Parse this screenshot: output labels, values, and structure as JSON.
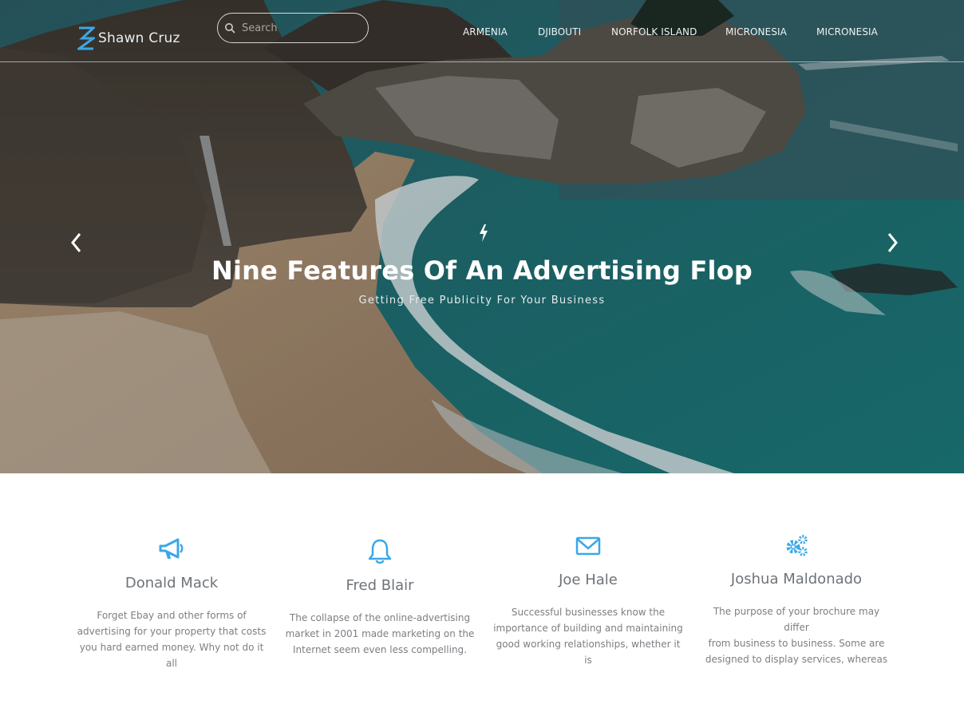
{
  "brand": {
    "name": "Shawn Cruz"
  },
  "search": {
    "placeholder": "Search"
  },
  "nav": {
    "items": [
      {
        "label": "ARMENIA"
      },
      {
        "label": "DJIBOUTI"
      },
      {
        "label": "NORFOLK ISLAND"
      },
      {
        "label": "MICRONESIA"
      },
      {
        "label": "MICRONESIA"
      }
    ]
  },
  "hero": {
    "title": "Nine Features Of An Advertising Flop",
    "subtitle": "Getting Free Publicity For Your Business"
  },
  "features": [
    {
      "icon": "megaphone-icon",
      "title": "Donald Mack",
      "lines": [
        "Forget Ebay and other forms of",
        "advertising for your property that costs",
        "you hard earned money. Why not do it all"
      ]
    },
    {
      "icon": "bell-icon",
      "title": "Fred Blair",
      "lines": [
        "The collapse of the online-advertising",
        "market in 2001 made marketing on the",
        "Internet seem even less compelling."
      ]
    },
    {
      "icon": "envelope-icon",
      "title": "Joe Hale",
      "lines": [
        "Successful businesses know the",
        "importance of building and maintaining",
        "good working relationships, whether it is"
      ]
    },
    {
      "icon": "gears-icon",
      "title": "Joshua Maldonado",
      "lines": [
        "The purpose of your brochure may differ",
        "from business to business. Some are",
        "designed to display services, whereas"
      ]
    }
  ],
  "colors": {
    "accent": "#3aa8e8",
    "title_text": "#6e7378",
    "body_text": "#7b7f83"
  }
}
